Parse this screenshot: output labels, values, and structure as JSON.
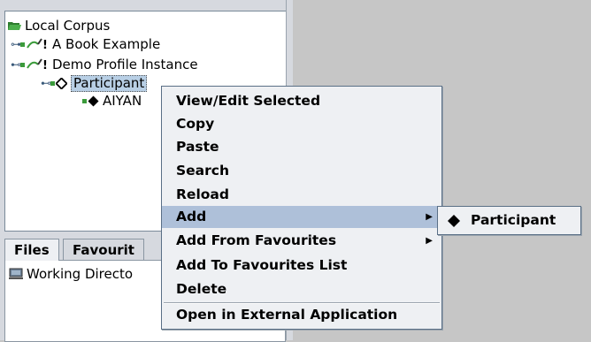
{
  "tree": {
    "root_label": "Local Corpus",
    "items": [
      {
        "label": "A Book Example"
      },
      {
        "label": "Demo Profile Instance"
      },
      {
        "label": "Participant"
      },
      {
        "label": "AIYAN"
      }
    ]
  },
  "tabs": [
    {
      "label": "Files"
    },
    {
      "label": "Favourit"
    }
  ],
  "files": {
    "item_label": "Working Directo"
  },
  "context_menu": {
    "items": [
      {
        "label": "View/Edit Selected"
      },
      {
        "label": "Copy"
      },
      {
        "label": "Paste"
      },
      {
        "label": "Search"
      },
      {
        "label": "Reload"
      },
      {
        "label": "Add"
      },
      {
        "label": "Add From Favourites"
      },
      {
        "label": "Add To Favourites List"
      },
      {
        "label": "Delete"
      },
      {
        "label": "Open in External Application"
      }
    ]
  },
  "submenu": {
    "items": [
      {
        "label": "Participant"
      }
    ]
  },
  "colors": {
    "selection": "#aec0d9",
    "folder_green": "#3b9b3b",
    "menu_bg": "#eef0f3"
  }
}
